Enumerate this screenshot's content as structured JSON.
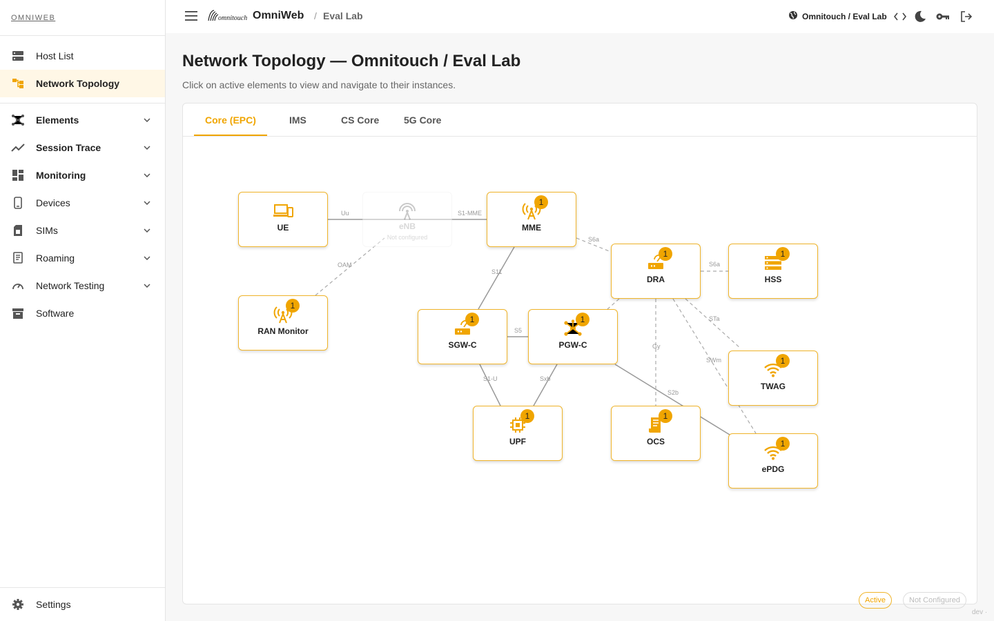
{
  "brand": "OMNIWEB",
  "sidebar": {
    "items": [
      {
        "label": "Host List",
        "icon": "server-list-icon"
      },
      {
        "label": "Network Topology",
        "icon": "topology-icon"
      },
      {
        "label": "Elements",
        "icon": "elements-icon"
      },
      {
        "label": "Session Trace",
        "icon": "trace-icon"
      },
      {
        "label": "Monitoring",
        "icon": "dashboard-icon"
      },
      {
        "label": "Devices",
        "icon": "phone-icon"
      },
      {
        "label": "SIMs",
        "icon": "sim-icon"
      },
      {
        "label": "Roaming",
        "icon": "roaming-icon"
      },
      {
        "label": "Network Testing",
        "icon": "speedometer-icon"
      },
      {
        "label": "Software",
        "icon": "archive-icon"
      }
    ],
    "settings": "Settings"
  },
  "header": {
    "app_name": "OmniWeb",
    "logo_text": "omnitouch",
    "breadcrumb_sep": "/",
    "breadcrumb": "Eval Lab",
    "tenant": "Omnitouch / Eval Lab"
  },
  "main": {
    "title": "Network Topology — Omnitouch / Eval Lab",
    "subtitle": "Click on active elements to view and navigate to their instances.",
    "tabs": [
      "Core (EPC)",
      "IMS",
      "CS Core",
      "5G Core"
    ]
  },
  "topology": {
    "nodes": [
      {
        "label": "UE",
        "badge": ""
      },
      {
        "label": "eNB",
        "sub": "Not configured"
      },
      {
        "label": "MME",
        "badge": "1"
      },
      {
        "label": "RAN Monitor",
        "badge": "1"
      },
      {
        "label": "DRA",
        "badge": "1"
      },
      {
        "label": "HSS",
        "badge": "1"
      },
      {
        "label": "SGW-C",
        "badge": "1"
      },
      {
        "label": "PGW-C",
        "badge": "1"
      },
      {
        "label": "TWAG",
        "badge": "1"
      },
      {
        "label": "UPF",
        "badge": "1"
      },
      {
        "label": "OCS",
        "badge": "1"
      },
      {
        "label": "ePDG",
        "badge": "1"
      }
    ],
    "edges": [
      "Uu",
      "S1-MME",
      "OAM",
      "S6a",
      "S6a",
      "S11",
      "S5",
      "Gy",
      "STa",
      "SWm",
      "S1-U",
      "Sxb",
      "S2b"
    ]
  },
  "legend": {
    "active": "Active",
    "not_configured": "Not Configured"
  },
  "footer": {
    "env": "dev ·"
  },
  "colors": {
    "accent": "#f0a500",
    "active_bg": "#fff7e6"
  }
}
